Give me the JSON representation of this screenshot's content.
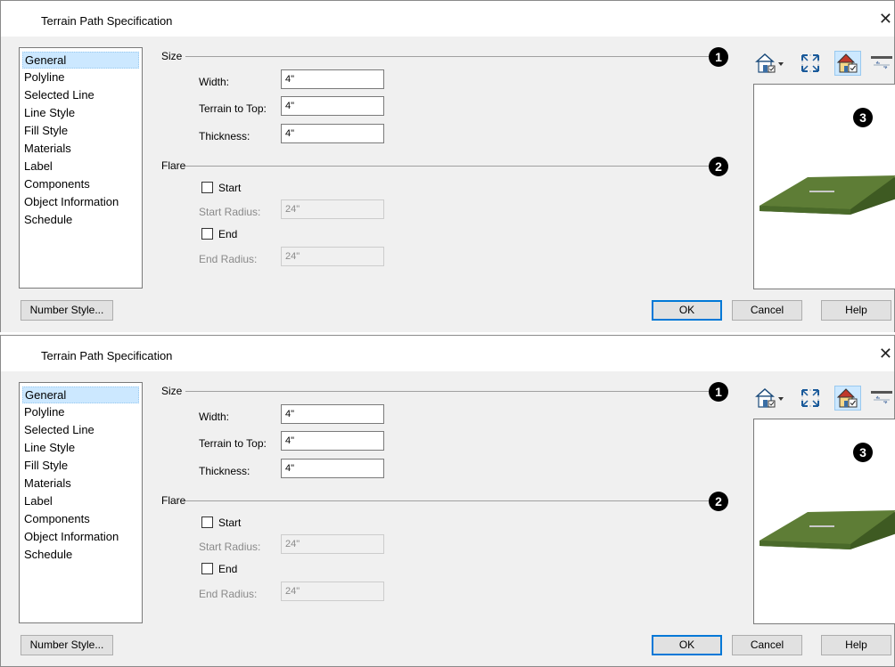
{
  "dialog_title": "Terrain Path Specification",
  "sidebar_items": [
    "General",
    "Polyline",
    "Selected Line",
    "Line Style",
    "Fill Style",
    "Materials",
    "Label",
    "Components",
    "Object Information",
    "Schedule"
  ],
  "selected_item": "General",
  "size_section": {
    "label": "Size",
    "width_label": "Width:",
    "width_value": "4\"",
    "terrain_top_label": "Terrain to Top:",
    "terrain_top_value": "4\"",
    "thickness_label": "Thickness:",
    "thickness_value": "4\""
  },
  "flare_section": {
    "label": "Flare",
    "start_label": "Start",
    "start_checked": false,
    "start_radius_label": "Start Radius:",
    "start_radius_value": "24\"",
    "end_label": "End",
    "end_checked": false,
    "end_radius_label": "End Radius:",
    "end_radius_value": "24\""
  },
  "callouts": [
    "1",
    "2",
    "3"
  ],
  "buttons": {
    "number_style": "Number Style...",
    "ok": "OK",
    "cancel": "Cancel",
    "help": "Help"
  },
  "preview_toolbar": [
    "view-options-icon",
    "fill-window-icon",
    "color-toggle-icon",
    "material-legend-icon"
  ],
  "colors": {
    "selection": "#cce8ff",
    "default_button_border": "#0078d7",
    "preview_terrain": "#5e7d36"
  }
}
